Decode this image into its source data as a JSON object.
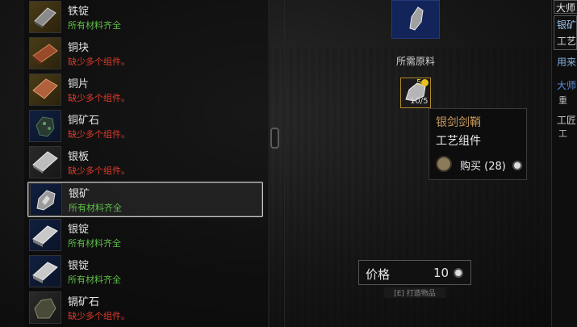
{
  "materials_list": {
    "items": [
      {
        "name": "铁锭",
        "status": "所有材料齐全",
        "status_type": "ok",
        "icon": "iron-ingot-icon",
        "frame": "gold"
      },
      {
        "name": "铜块",
        "status": "缺少多个组件。",
        "status_type": "bad",
        "icon": "copper-bar-icon",
        "frame": "gold"
      },
      {
        "name": "铜片",
        "status": "缺少多个组件。",
        "status_type": "bad",
        "icon": "copper-plate-icon",
        "frame": "gold"
      },
      {
        "name": "铜矿石",
        "status": "缺少多个组件。",
        "status_type": "bad",
        "icon": "copper-ore-icon",
        "frame": "blue"
      },
      {
        "name": "银板",
        "status": "缺少多个组件。",
        "status_type": "bad",
        "icon": "silver-plate-icon",
        "frame": "gray"
      },
      {
        "name": "银矿",
        "status": "所有材料齐全",
        "status_type": "ok",
        "icon": "silver-ore-icon",
        "frame": "blue",
        "selected": true
      },
      {
        "name": "银锭",
        "status": "所有材料齐全",
        "status_type": "ok",
        "icon": "silver-ingot-icon",
        "frame": "blue"
      },
      {
        "name": "银锭",
        "status": "所有材料齐全",
        "status_type": "ok",
        "icon": "silver-ingot-icon",
        "frame": "blue"
      },
      {
        "name": "镉矿石",
        "status": "缺少多个组件。",
        "status_type": "bad",
        "icon": "cadmium-ore-icon",
        "frame": "gray"
      }
    ]
  },
  "crafting": {
    "required_label": "所需原料",
    "slot_count": "10/5",
    "slot_badge_count": "5",
    "tooltip": {
      "name": "银剑剑鞘",
      "type": "工艺组件",
      "buy_label": "购买 (28)"
    },
    "price_label": "价格",
    "price_value": "10",
    "craft_hint": "[E] 打造物品"
  },
  "right_panel": {
    "title": "大师",
    "line1": "银矿",
    "line2": "工艺",
    "line3": "用来",
    "line4": "大师",
    "line5": "重",
    "line6": "工匠",
    "line7": "工"
  },
  "colors": {
    "ok": "#5fbf4a",
    "bad": "#e03a2c",
    "tooltip_name": "#c89a5a"
  }
}
